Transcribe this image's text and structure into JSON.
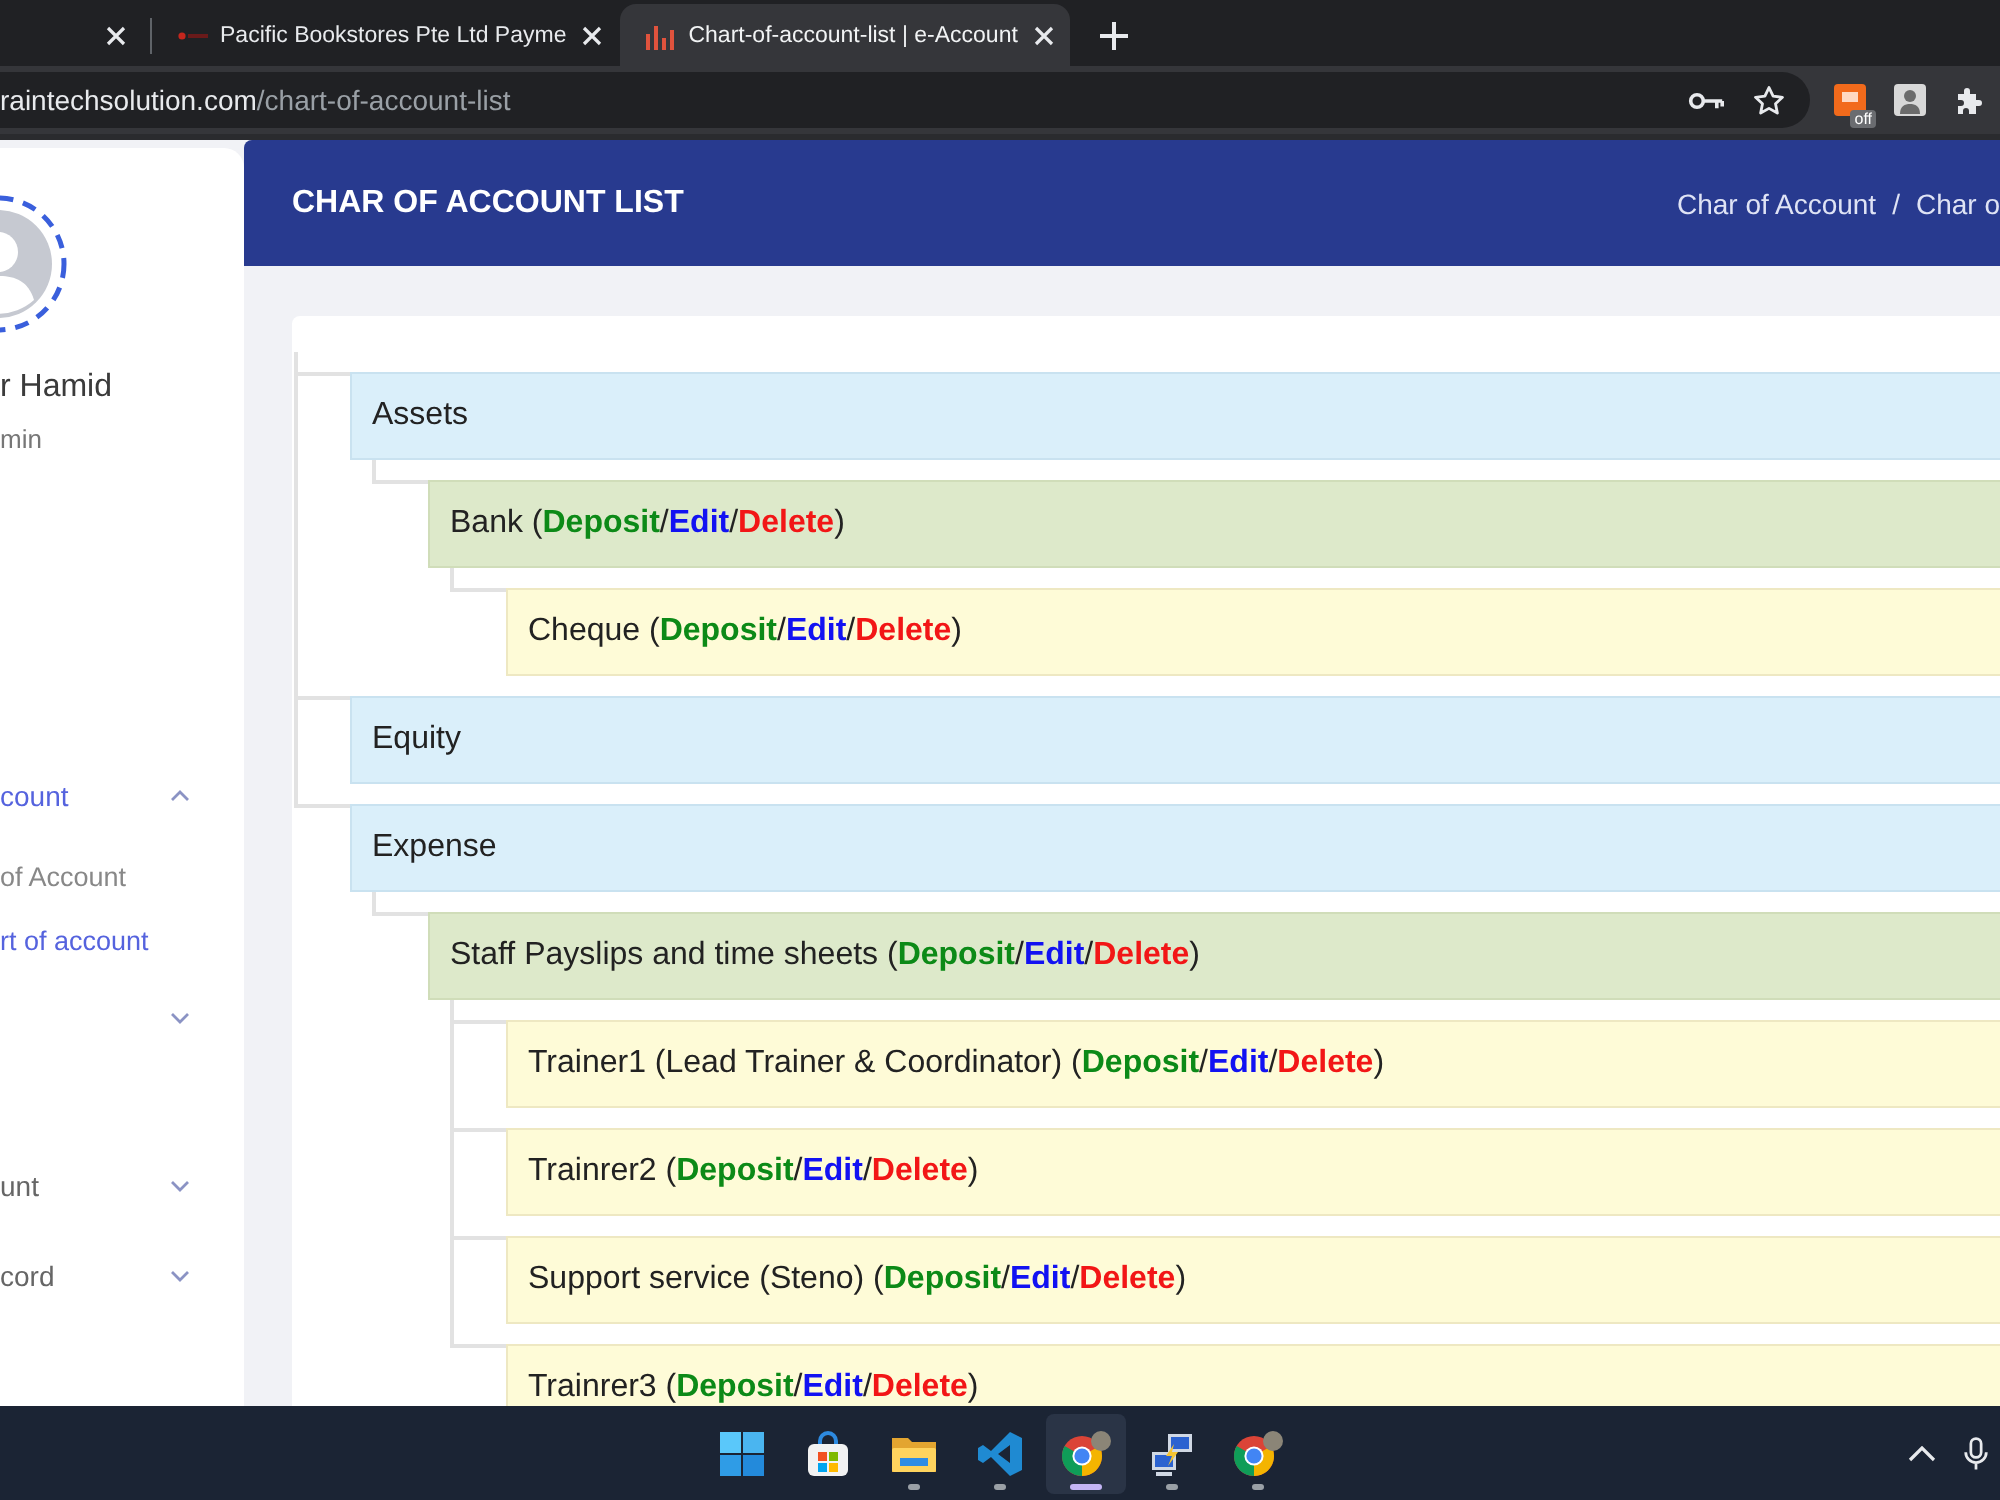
{
  "browser": {
    "tabs": [
      {
        "kind": "blank",
        "selected": false
      },
      {
        "kind": "site",
        "title": "Pacific Bookstores Pte Ltd Payme",
        "selected": false
      },
      {
        "kind": "chart",
        "title": "Chart-of-account-list | e-Account",
        "selected": true
      }
    ],
    "address_bar": {
      "host": "raintechsolution.com",
      "path": "/chart-of-account-list"
    },
    "extensions": [
      {
        "kind": "square",
        "badge": "off"
      },
      {
        "kind": "portrait"
      },
      {
        "kind": "puzzle"
      }
    ]
  },
  "sidebar": {
    "user": {
      "name": "r Hamid",
      "role": "min"
    },
    "menu": [
      {
        "label": "count",
        "selected": true,
        "expanded": true,
        "children": [
          {
            "label": "of Account",
            "selected": false
          },
          {
            "label": "rt of account",
            "selected": true
          }
        ]
      },
      {
        "expanded": false
      },
      {
        "label": "unt",
        "selected": false,
        "expanded": false
      },
      {
        "label": "cord",
        "selected": false,
        "expanded": false
      }
    ]
  },
  "header": {
    "title": "CHAR OF ACCOUNT LIST",
    "breadcrumb": [
      "Char of Account",
      "Char o"
    ],
    "breadcrumb_separator": "/"
  },
  "account_tree": {
    "action_open": "(",
    "action_separator": "/",
    "action_close": ")",
    "accounts": [
      {
        "name": "Assets",
        "children": [
          {
            "name": "Bank",
            "actions": [
              {
                "kind": "deposit",
                "label": "Deposit"
              },
              {
                "kind": "edit",
                "label": "Edit"
              },
              {
                "kind": "delete",
                "label": "Delete"
              }
            ],
            "children": [
              {
                "name": "Cheque",
                "actions": [
                  {
                    "kind": "deposit",
                    "label": "Deposit"
                  },
                  {
                    "kind": "edit",
                    "label": "Edit"
                  },
                  {
                    "kind": "delete",
                    "label": "Delete"
                  }
                ]
              }
            ]
          }
        ]
      },
      {
        "name": "Equity"
      },
      {
        "name": "Expense",
        "children": [
          {
            "name": "Staff Payslips and time sheets",
            "actions": [
              {
                "kind": "deposit",
                "label": "Deposit"
              },
              {
                "kind": "edit",
                "label": "Edit"
              },
              {
                "kind": "delete",
                "label": "Delete"
              }
            ],
            "children": [
              {
                "name": "Trainer1 (Lead Trainer & Coordinator)",
                "actions": [
                  {
                    "kind": "deposit",
                    "label": "Deposit"
                  },
                  {
                    "kind": "edit",
                    "label": "Edit"
                  },
                  {
                    "kind": "delete",
                    "label": "Delete"
                  }
                ]
              },
              {
                "name": "Trainrer2",
                "actions": [
                  {
                    "kind": "deposit",
                    "label": "Deposit"
                  },
                  {
                    "kind": "edit",
                    "label": "Edit"
                  },
                  {
                    "kind": "delete",
                    "label": "Delete"
                  }
                ]
              },
              {
                "name": "Support service (Steno)",
                "actions": [
                  {
                    "kind": "deposit",
                    "label": "Deposit"
                  },
                  {
                    "kind": "edit",
                    "label": "Edit"
                  },
                  {
                    "kind": "delete",
                    "label": "Delete"
                  }
                ]
              },
              {
                "name": "Trainrer3",
                "actions": [
                  {
                    "kind": "deposit",
                    "label": "Deposit"
                  },
                  {
                    "kind": "edit",
                    "label": "Edit"
                  },
                  {
                    "kind": "delete",
                    "label": "Delete"
                  }
                ]
              }
            ]
          }
        ]
      }
    ]
  },
  "taskbar": {
    "apps": [
      {
        "kind": "start",
        "running": false,
        "selected": false
      },
      {
        "kind": "store",
        "running": false,
        "selected": false
      },
      {
        "kind": "explorer",
        "running": true,
        "selected": false
      },
      {
        "kind": "code",
        "running": true,
        "selected": false
      },
      {
        "kind": "chrome",
        "running": true,
        "selected": true
      },
      {
        "kind": "remote",
        "running": true,
        "selected": false
      },
      {
        "kind": "chrome",
        "running": true,
        "selected": false
      }
    ]
  }
}
